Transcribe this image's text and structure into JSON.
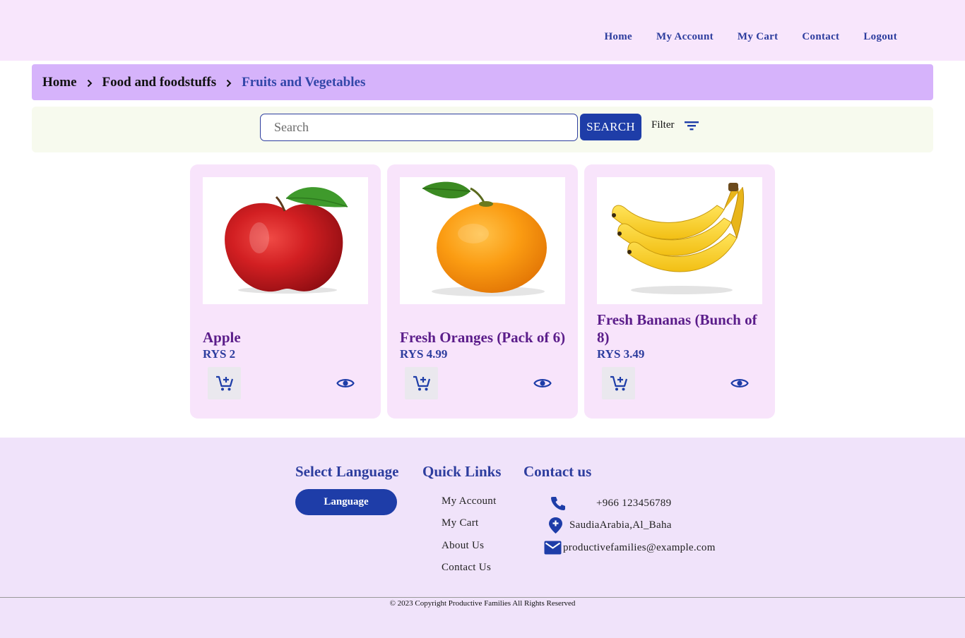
{
  "nav": {
    "items": [
      "Home",
      "My Account",
      "My Cart",
      "Contact",
      "Logout"
    ]
  },
  "breadcrumb": {
    "items": [
      "Home",
      "Food and foodstuffs",
      "Fruits and Vegetables"
    ]
  },
  "search": {
    "placeholder": "Search",
    "button_label": "SEARCH",
    "filter_label": "Filter"
  },
  "products": [
    {
      "name": "Apple",
      "price": "RYS 2",
      "image": "apple-image"
    },
    {
      "name": "Fresh Oranges (Pack of 6)",
      "price": "RYS 4.99",
      "image": "orange-image"
    },
    {
      "name": "Fresh Bananas (Bunch of 8)",
      "price": "RYS 3.49",
      "image": "banana-image"
    }
  ],
  "footer": {
    "language": {
      "heading": "Select Language",
      "button_label": "Language"
    },
    "quick_links": {
      "heading": "Quick Links",
      "items": [
        "My Account",
        "My Cart",
        "About Us",
        "Contact Us"
      ]
    },
    "contact": {
      "heading": "Contact us",
      "phone": "+966 123456789",
      "location": "SaudiaArabia,Al_Baha",
      "email": "productivefamilies@example.com"
    },
    "copyright": "© 2023 Copyright Productive Families All Rights Reserved"
  },
  "colors": {
    "primary": "#1e3da8",
    "nav_text": "#2d3d9e",
    "product_title": "#5b1d8a",
    "header_bg": "#f8e6fc",
    "breadcrumb_bg": "#d6b3fb",
    "footer_bg": "#f0e3fa"
  }
}
